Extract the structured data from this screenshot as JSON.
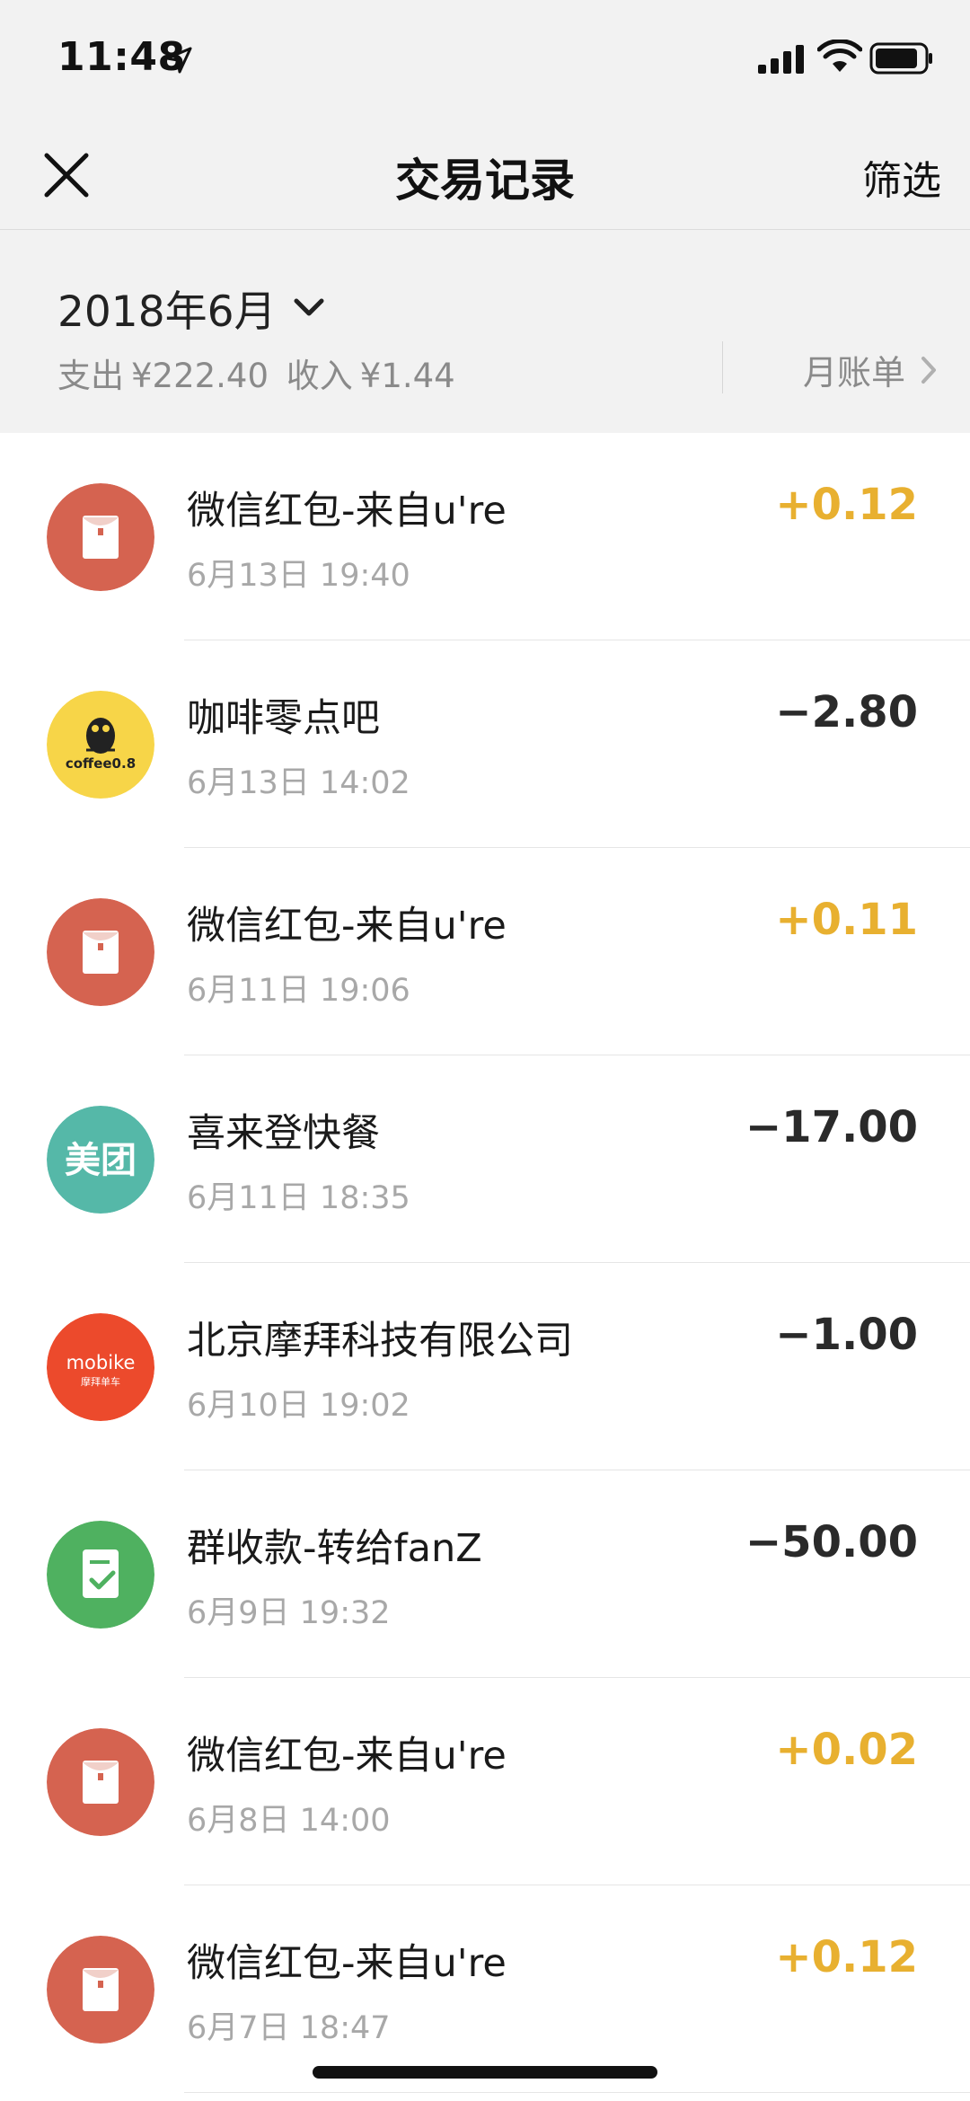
{
  "status_bar": {
    "time": "11:48"
  },
  "nav": {
    "title": "交易记录",
    "filter_label": "筛选"
  },
  "month_header": {
    "month": "2018年6月",
    "expense_label": "支出",
    "expense_value": "¥222.40",
    "income_label": "收入",
    "income_value": "¥1.44",
    "bill_link": "月账单"
  },
  "colors": {
    "income": "#e8b030",
    "expense": "#2a2a2a",
    "red_packet": "#d56350",
    "coffee": "#f7d548",
    "meituan": "#55b8a8",
    "mobike": "#ec4a2c",
    "group_collect": "#4fb160"
  },
  "transactions": [
    {
      "title": "微信红包-来自u're",
      "date": "6月13日 19:40",
      "amount": "+0.12",
      "type": "income",
      "icon": "red-packet-icon"
    },
    {
      "title": "咖啡零点吧",
      "date": "6月13日 14:02",
      "amount": "−2.80",
      "type": "expense",
      "icon": "coffee-owl-icon",
      "icon_text": "coffee0.8"
    },
    {
      "title": "微信红包-来自u're",
      "date": "6月11日 19:06",
      "amount": "+0.11",
      "type": "income",
      "icon": "red-packet-icon"
    },
    {
      "title": "喜来登快餐",
      "date": "6月11日 18:35",
      "amount": "−17.00",
      "type": "expense",
      "icon": "meituan-icon",
      "icon_text": "美团"
    },
    {
      "title": "北京摩拜科技有限公司",
      "date": "6月10日 19:02",
      "amount": "−1.00",
      "type": "expense",
      "icon": "mobike-icon",
      "icon_text": "mobike",
      "icon_subtext": "摩拜单车"
    },
    {
      "title": "群收款-转给fanZ",
      "date": "6月9日 19:32",
      "amount": "−50.00",
      "type": "expense",
      "icon": "group-collect-icon"
    },
    {
      "title": "微信红包-来自u're",
      "date": "6月8日 14:00",
      "amount": "+0.02",
      "type": "income",
      "icon": "red-packet-icon"
    },
    {
      "title": "微信红包-来自u're",
      "date": "6月7日 18:47",
      "amount": "+0.12",
      "type": "income",
      "icon": "red-packet-icon"
    }
  ]
}
